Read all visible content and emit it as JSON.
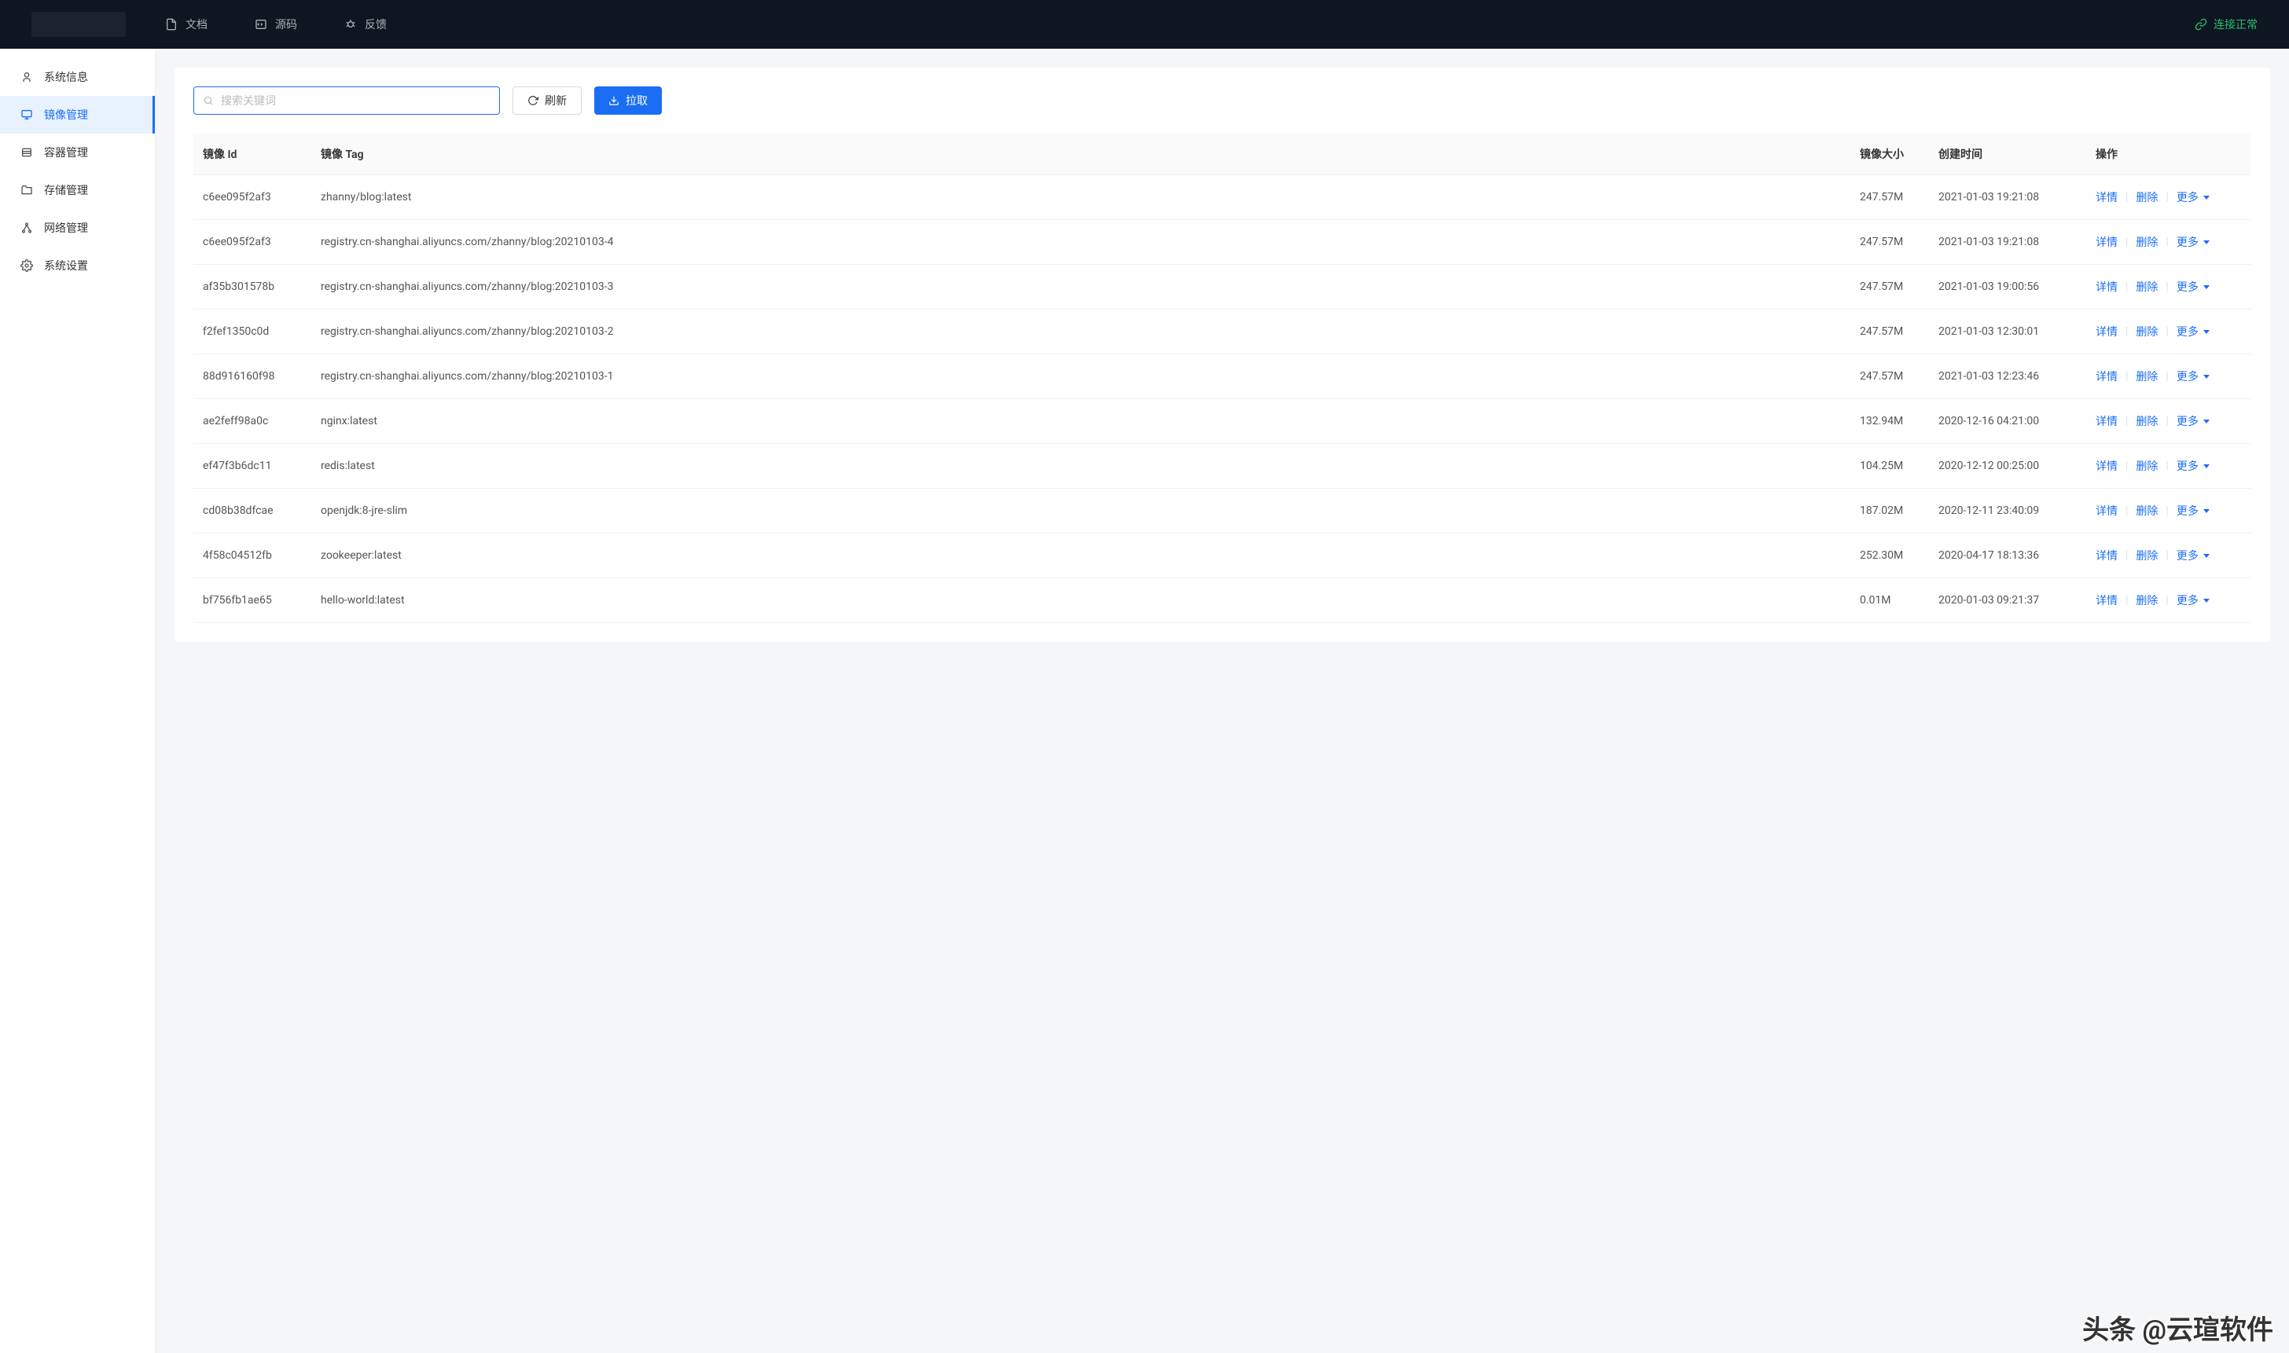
{
  "header": {
    "nav": [
      {
        "label": "文档",
        "icon": "file-icon"
      },
      {
        "label": "源码",
        "icon": "code-icon"
      },
      {
        "label": "反馈",
        "icon": "bug-icon"
      }
    ],
    "status": "连接正常"
  },
  "sidebar": {
    "items": [
      {
        "label": "系统信息",
        "icon": "user-icon"
      },
      {
        "label": "镜像管理",
        "icon": "monitor-icon",
        "active": true
      },
      {
        "label": "容器管理",
        "icon": "layers-icon"
      },
      {
        "label": "存储管理",
        "icon": "folder-icon"
      },
      {
        "label": "网络管理",
        "icon": "network-icon"
      },
      {
        "label": "系统设置",
        "icon": "gear-icon"
      }
    ]
  },
  "toolbar": {
    "search_placeholder": "搜索关键词",
    "refresh_label": "刷新",
    "pull_label": "拉取"
  },
  "table": {
    "columns": {
      "id": "镜像 Id",
      "tag": "镜像 Tag",
      "size": "镜像大小",
      "created": "创建时间",
      "actions": "操作"
    },
    "action_labels": {
      "detail": "详情",
      "delete": "删除",
      "more": "更多"
    },
    "rows": [
      {
        "id": "c6ee095f2af3",
        "tag": "zhanny/blog:latest",
        "size": "247.57M",
        "created": "2021-01-03 19:21:08"
      },
      {
        "id": "c6ee095f2af3",
        "tag": "registry.cn-shanghai.aliyuncs.com/zhanny/blog:20210103-4",
        "size": "247.57M",
        "created": "2021-01-03 19:21:08"
      },
      {
        "id": "af35b301578b",
        "tag": "registry.cn-shanghai.aliyuncs.com/zhanny/blog:20210103-3",
        "size": "247.57M",
        "created": "2021-01-03 19:00:56"
      },
      {
        "id": "f2fef1350c0d",
        "tag": "registry.cn-shanghai.aliyuncs.com/zhanny/blog:20210103-2",
        "size": "247.57M",
        "created": "2021-01-03 12:30:01"
      },
      {
        "id": "88d916160f98",
        "tag": "registry.cn-shanghai.aliyuncs.com/zhanny/blog:20210103-1",
        "size": "247.57M",
        "created": "2021-01-03 12:23:46"
      },
      {
        "id": "ae2feff98a0c",
        "tag": "nginx:latest",
        "size": "132.94M",
        "created": "2020-12-16 04:21:00"
      },
      {
        "id": "ef47f3b6dc11",
        "tag": "redis:latest",
        "size": "104.25M",
        "created": "2020-12-12 00:25:00"
      },
      {
        "id": "cd08b38dfcae",
        "tag": "openjdk:8-jre-slim",
        "size": "187.02M",
        "created": "2020-12-11 23:40:09"
      },
      {
        "id": "4f58c04512fb",
        "tag": "zookeeper:latest",
        "size": "252.30M",
        "created": "2020-04-17 18:13:36"
      },
      {
        "id": "bf756fb1ae65",
        "tag": "hello-world:latest",
        "size": "0.01M",
        "created": "2020-01-03 09:21:37"
      }
    ]
  },
  "watermark": "头条 @云瑄软件"
}
